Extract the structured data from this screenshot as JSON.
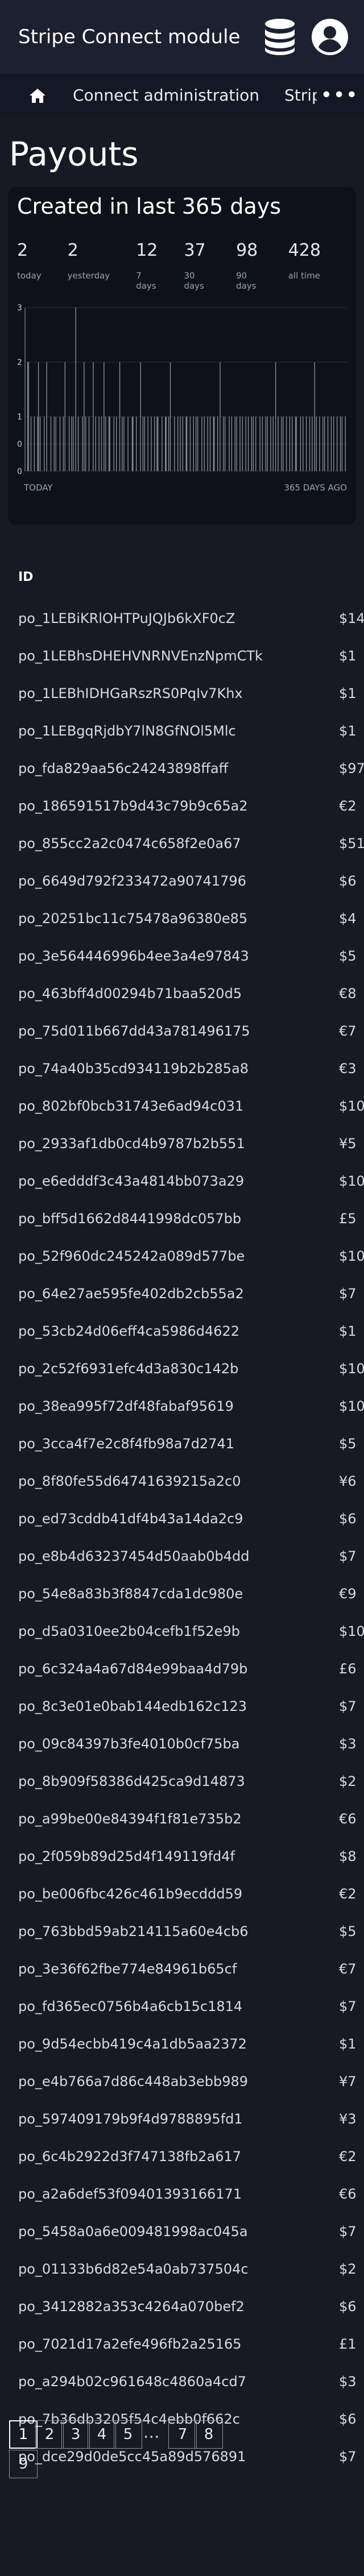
{
  "app": {
    "title": "Stripe Connect module"
  },
  "header": {
    "database_icon": "database-icon",
    "account_icon": "account-circle-icon"
  },
  "nav": {
    "home_icon": "home-icon",
    "items": [
      "Connect administration",
      "Strip"
    ],
    "more_icon": "more-dots-icon"
  },
  "page": {
    "title": "Payouts"
  },
  "summary": {
    "title": "Created in last 365 days",
    "stats": [
      {
        "value": "2",
        "label": "today"
      },
      {
        "value": "2",
        "label": "yesterday"
      },
      {
        "value": "12",
        "label": "7 days"
      },
      {
        "value": "37",
        "label": "30 days"
      },
      {
        "value": "98",
        "label": "90 days"
      },
      {
        "value": "428",
        "label": "all time"
      }
    ],
    "footer_left": "TODAY",
    "footer_right": "365 DAYS AGO"
  },
  "chart_data": {
    "type": "bar",
    "ylim": [
      0,
      3
    ],
    "y_ticks": [
      "3",
      "2",
      "1",
      "0",
      "0"
    ],
    "x_labels": [
      "TODAY",
      "365 DAYS AGO"
    ],
    "grid": true,
    "values": [
      2,
      2,
      0,
      0,
      1,
      0,
      0,
      0,
      1,
      0,
      0,
      0,
      1,
      2,
      0,
      1,
      0,
      0,
      0,
      0,
      1,
      0,
      0,
      2,
      0,
      0,
      0,
      0,
      1,
      0,
      0,
      0,
      1,
      0,
      1,
      0,
      0,
      0,
      0,
      1,
      0,
      0,
      0,
      1,
      0,
      2,
      0,
      0,
      0,
      0,
      1,
      0,
      0,
      1,
      0,
      1,
      0,
      0,
      3,
      0,
      0,
      1,
      0,
      0,
      0,
      0,
      1,
      0,
      2,
      0,
      1,
      0,
      0,
      0,
      1,
      0,
      0,
      0,
      0,
      2,
      0,
      0,
      1,
      0,
      0,
      0,
      1,
      0,
      0,
      1,
      0,
      0,
      2,
      0,
      1,
      0,
      0,
      0,
      1,
      1,
      0,
      0,
      0,
      0,
      1,
      0,
      0,
      1,
      0,
      0,
      0,
      2,
      0,
      0,
      1,
      0,
      1,
      0,
      0,
      0,
      0,
      1,
      0,
      0,
      0,
      0,
      1,
      1,
      0,
      0,
      0,
      1,
      0,
      0,
      0,
      0,
      2,
      0,
      0,
      1,
      0,
      1,
      0,
      0,
      0,
      1,
      0,
      0,
      0,
      1,
      0,
      0,
      0,
      1,
      0,
      0,
      1,
      1,
      0,
      0,
      0,
      0,
      1,
      0,
      0,
      0,
      1,
      1,
      0,
      0,
      1,
      0,
      2,
      0,
      0,
      0,
      0,
      1,
      0,
      0,
      0,
      1,
      0,
      0,
      1,
      0,
      0,
      1,
      0,
      0,
      0,
      1,
      1,
      0,
      0,
      0,
      1,
      0,
      0,
      0,
      1,
      0,
      0,
      1,
      0,
      1,
      0,
      0,
      0,
      0,
      1,
      0,
      0,
      1,
      0,
      0,
      0,
      1,
      0,
      0,
      1,
      0,
      0,
      0,
      1,
      1,
      0,
      0,
      0,
      1,
      0,
      0,
      2,
      0,
      0,
      0,
      1,
      0,
      1,
      0,
      0,
      0,
      0,
      1,
      0,
      0,
      1,
      0,
      0,
      0,
      1,
      0,
      1,
      0,
      0,
      0,
      1,
      0,
      0,
      1,
      0,
      0,
      0,
      1,
      0,
      0,
      1,
      0,
      0,
      0,
      1,
      0,
      1,
      0,
      0,
      1,
      0,
      0,
      0,
      0,
      1,
      0,
      0,
      1,
      0,
      0,
      0,
      1,
      0,
      1,
      0,
      0,
      0,
      1,
      0,
      0,
      1,
      0,
      0,
      2,
      0,
      0,
      1,
      0,
      0,
      0,
      1,
      0,
      1,
      0,
      0,
      0,
      1,
      0,
      0,
      0,
      1,
      0,
      0,
      1,
      0,
      0,
      0,
      1,
      1,
      0,
      0,
      0,
      0,
      1,
      0,
      0,
      1,
      0,
      0,
      0,
      1,
      0,
      0,
      0,
      1,
      0,
      0,
      1,
      0,
      0,
      2,
      0,
      1,
      0,
      0,
      0,
      1,
      0,
      0,
      0,
      1,
      0,
      1,
      0,
      0,
      0,
      1,
      0,
      0,
      0,
      1,
      0,
      0,
      1,
      0,
      0,
      0,
      1,
      0,
      0,
      0,
      1,
      0,
      1,
      0,
      0,
      0,
      1
    ]
  },
  "table": {
    "column_id": "ID",
    "rows": [
      {
        "id": "po_1LEBiKRlOHTPuJQJb6kXF0cZ",
        "amount": "$14"
      },
      {
        "id": "po_1LEBhsDHEHVNRNVEnzNpmCTk",
        "amount": "$1"
      },
      {
        "id": "po_1LEBhIDHGaRszRS0PqIv7Khx",
        "amount": "$1"
      },
      {
        "id": "po_1LEBgqRjdbY7lN8GfNOl5Mlc",
        "amount": "$1"
      },
      {
        "id": "po_fda829aa56c24243898ffaff",
        "amount": "$97"
      },
      {
        "id": "po_186591517b9d43c79b9c65a2",
        "amount": "€2"
      },
      {
        "id": "po_855cc2a2c0474c658f2e0a67",
        "amount": "$51"
      },
      {
        "id": "po_6649d792f233472a90741796",
        "amount": "$6"
      },
      {
        "id": "po_20251bc11c75478a96380e85",
        "amount": "$4"
      },
      {
        "id": "po_3e564446996b4ee3a4e97843",
        "amount": "$5"
      },
      {
        "id": "po_463bff4d00294b71baa520d5",
        "amount": "€8"
      },
      {
        "id": "po_75d011b667dd43a781496175",
        "amount": "€7"
      },
      {
        "id": "po_74a40b35cd934119b2b285a8",
        "amount": "€3"
      },
      {
        "id": "po_802bf0bcb31743e6ad94c031",
        "amount": "$10"
      },
      {
        "id": "po_2933af1db0cd4b9787b2b551",
        "amount": "¥5"
      },
      {
        "id": "po_e6edddf3c43a4814bb073a29",
        "amount": "$10"
      },
      {
        "id": "po_bff5d1662d8441998dc057bb",
        "amount": "£5"
      },
      {
        "id": "po_52f960dc245242a089d577be",
        "amount": "$10"
      },
      {
        "id": "po_64e27ae595fe402db2cb55a2",
        "amount": "$7"
      },
      {
        "id": "po_53cb24d06eff4ca5986d4622",
        "amount": "$1"
      },
      {
        "id": "po_2c52f6931efc4d3a830c142b",
        "amount": "$10"
      },
      {
        "id": "po_38ea995f72df48fabaf95619",
        "amount": "$10"
      },
      {
        "id": "po_3cca4f7e2c8f4fb98a7d2741",
        "amount": "$5"
      },
      {
        "id": "po_8f80fe55d64741639215a2c0",
        "amount": "¥6"
      },
      {
        "id": "po_ed73cddb41df4b43a14da2c9",
        "amount": "$6"
      },
      {
        "id": "po_e8b4d63237454d50aab0b4dd",
        "amount": "$7"
      },
      {
        "id": "po_54e8a83b3f8847cda1dc980e",
        "amount": "€9"
      },
      {
        "id": "po_d5a0310ee2b04cefb1f52e9b",
        "amount": "$10"
      },
      {
        "id": "po_6c324a4a67d84e99baa4d79b",
        "amount": "£6"
      },
      {
        "id": "po_8c3e01e0bab144edb162c123",
        "amount": "$7"
      },
      {
        "id": "po_09c84397b3fe4010b0cf75ba",
        "amount": "$3"
      },
      {
        "id": "po_8b909f58386d425ca9d14873",
        "amount": "$2"
      },
      {
        "id": "po_a99be00e84394f1f81e735b2",
        "amount": "€6"
      },
      {
        "id": "po_2f059b89d25d4f149119fd4f",
        "amount": "$8"
      },
      {
        "id": "po_be006fbc426c461b9ecddd59",
        "amount": "€2"
      },
      {
        "id": "po_763bbd59ab214115a60e4cb6",
        "amount": "$5"
      },
      {
        "id": "po_3e36f62fbe774e84961b65cf",
        "amount": "€7"
      },
      {
        "id": "po_fd365ec0756b4a6cb15c1814",
        "amount": "$7"
      },
      {
        "id": "po_9d54ecbb419c4a1db5aa2372",
        "amount": "$1"
      },
      {
        "id": "po_e4b766a7d86c448ab3ebb989",
        "amount": "¥7"
      },
      {
        "id": "po_597409179b9f4d9788895fd1",
        "amount": "¥3"
      },
      {
        "id": "po_6c4b2922d3f747138fb2a617",
        "amount": "€2"
      },
      {
        "id": "po_a2a6def53f09401393166171",
        "amount": "€6"
      },
      {
        "id": "po_5458a0a6e009481998ac045a",
        "amount": "$7"
      },
      {
        "id": "po_01133b6d82e54a0ab737504c",
        "amount": "$2"
      },
      {
        "id": "po_3412882a353c4264a070bef2",
        "amount": "$6"
      },
      {
        "id": "po_7021d17a2efe496fb2a25165",
        "amount": "£1"
      },
      {
        "id": "po_a294b02c961648c4860a4cd7",
        "amount": "$3"
      },
      {
        "id": "po_7b36db3205f54c4ebb0f662c",
        "amount": "$6"
      },
      {
        "id": "po_dce29d0de5cc45a89d576891",
        "amount": "$7"
      }
    ]
  },
  "pagination": {
    "pages": [
      "1",
      "2",
      "3",
      "4",
      "5",
      "7",
      "8",
      "9"
    ],
    "current": "1",
    "ellipsis": "..."
  }
}
